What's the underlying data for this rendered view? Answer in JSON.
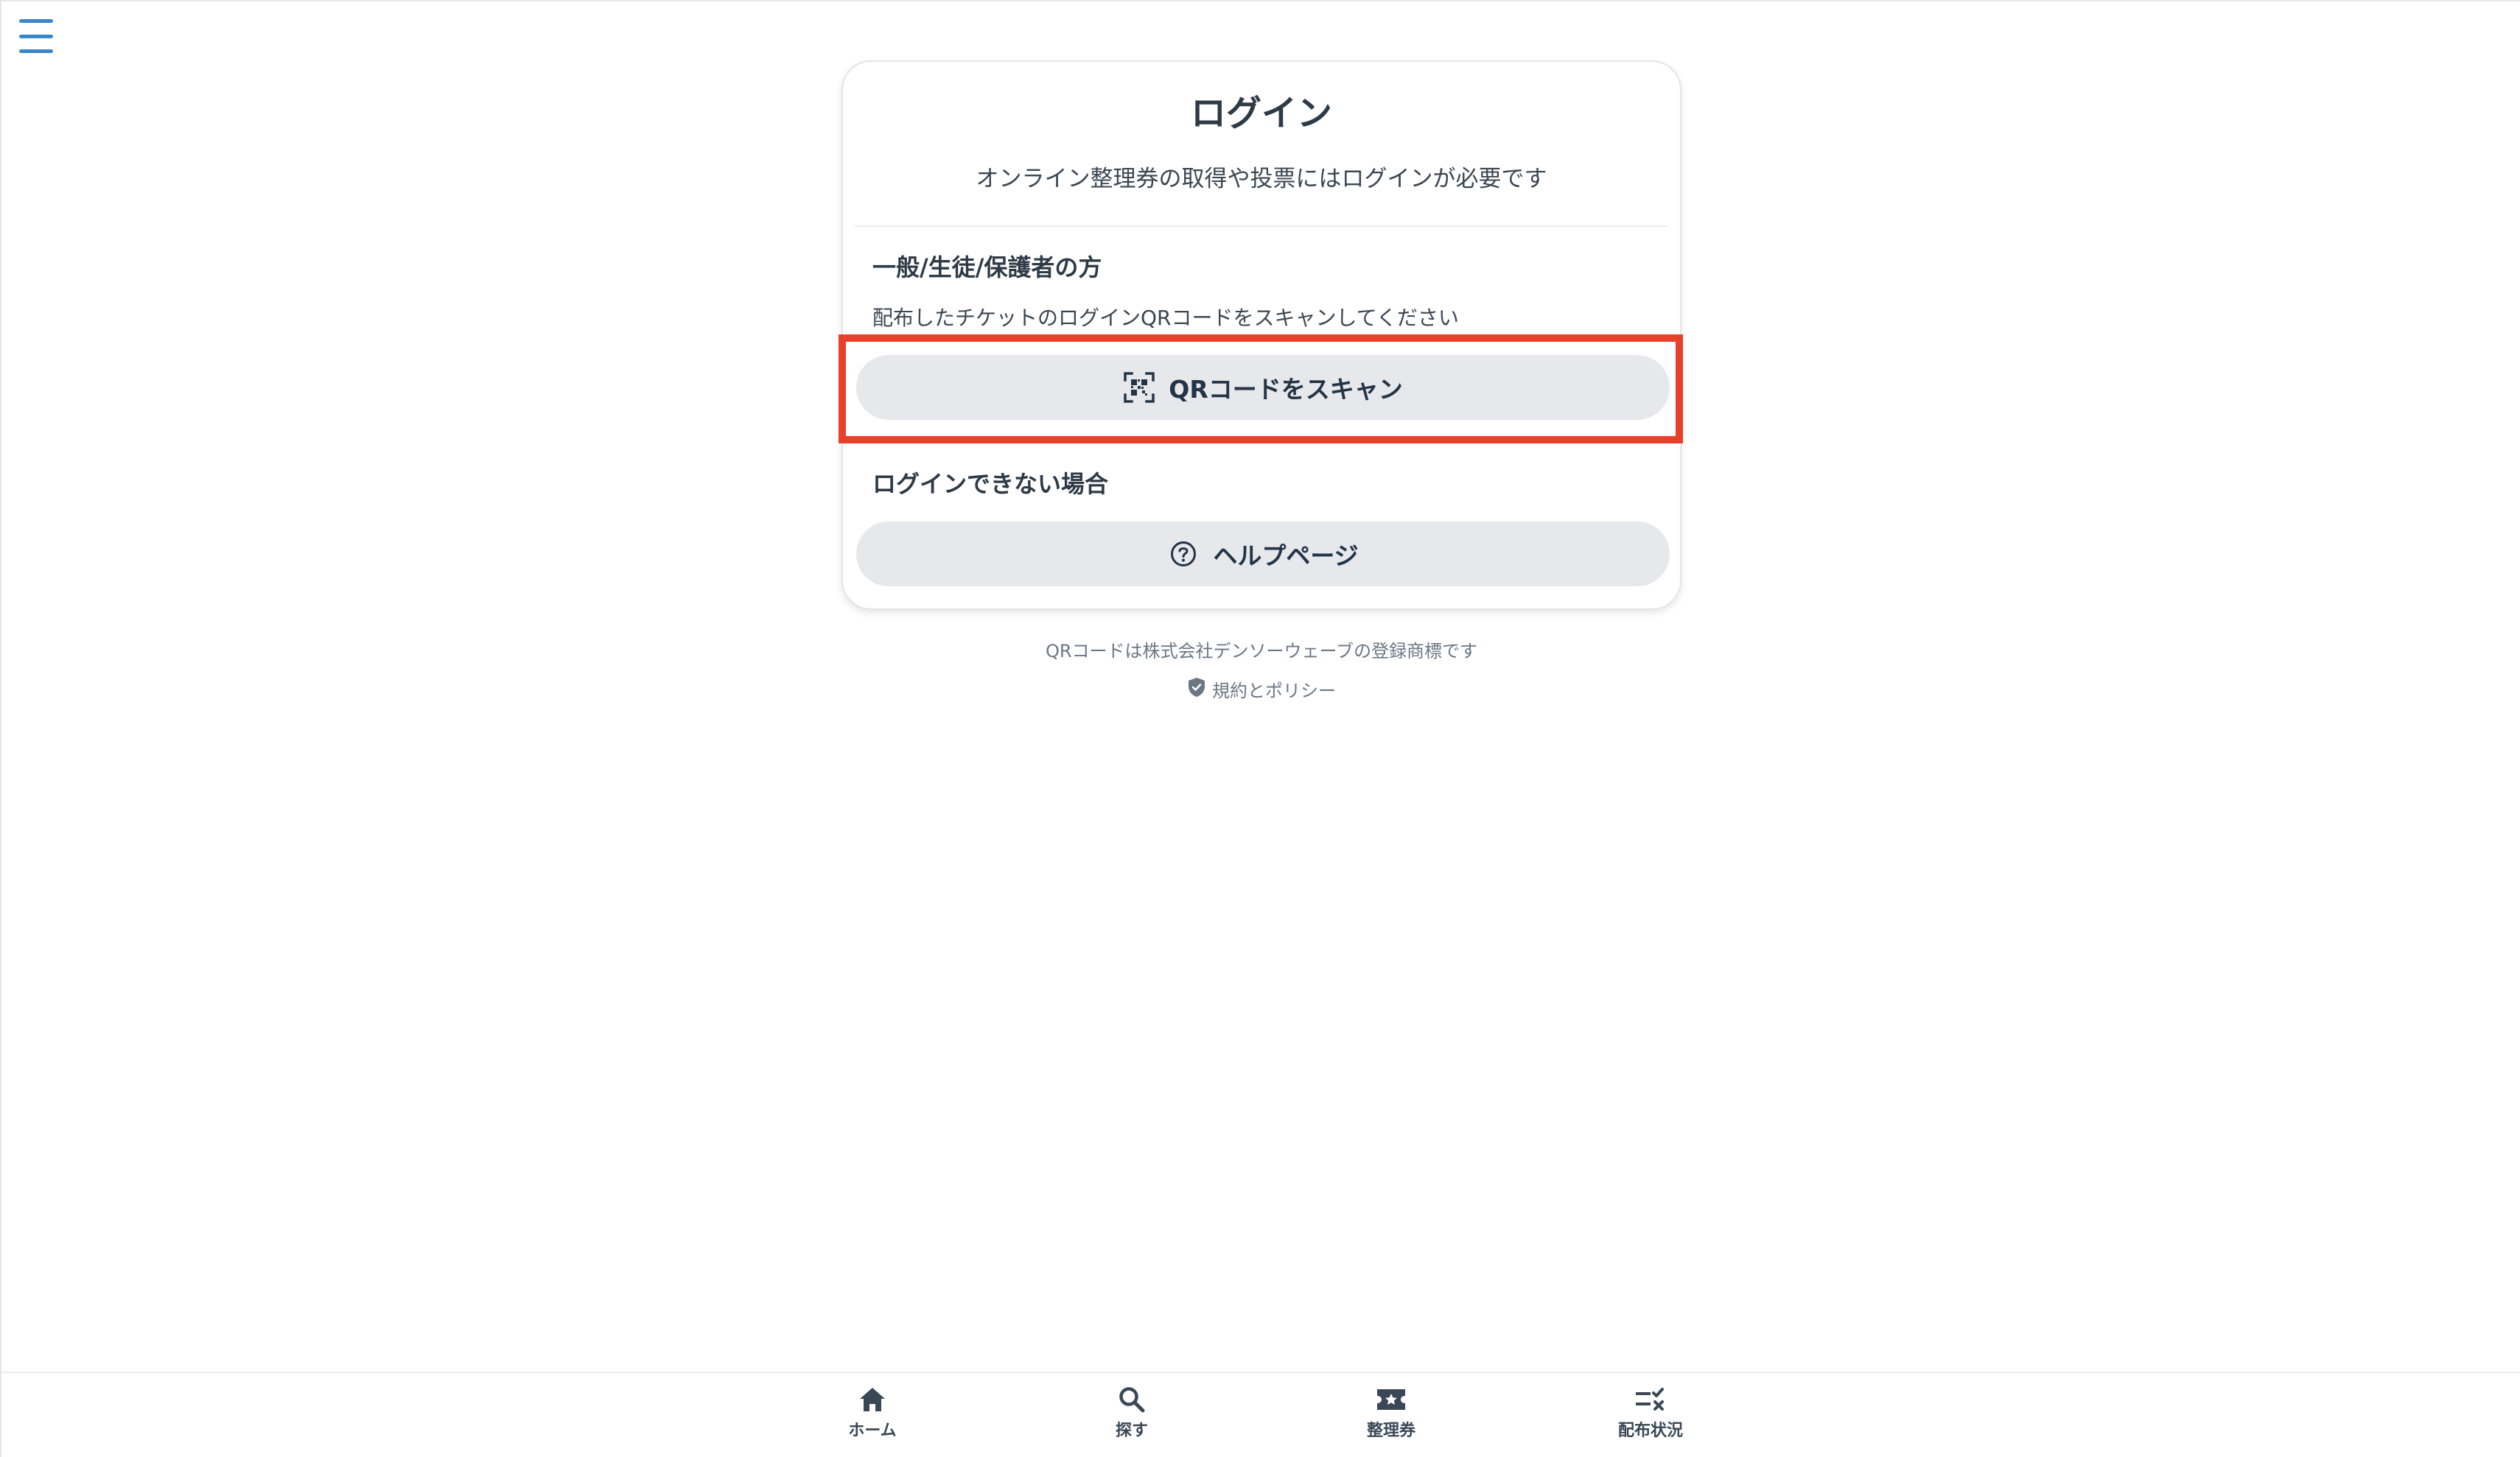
{
  "menu": {
    "icon": "hamburger-menu-icon",
    "color": "#3a86c8"
  },
  "card": {
    "title": "ログイン",
    "subtitle": "オンライン整理券の取得や投票にはログインが必要です",
    "general_section": {
      "heading": "一般/生徒/保護者の方",
      "description": "配布したチケットのログインQRコードをスキャンしてください",
      "scan_button": {
        "label": "QRコードをスキャン",
        "icon": "qr-code-scan-icon"
      }
    },
    "help_section": {
      "heading": "ログインできない場合",
      "help_button": {
        "label": "ヘルプページ",
        "icon": "help-circle-icon"
      }
    }
  },
  "footer": {
    "trademark": "QRコードは株式会社デンソーウェーブの登録商標です",
    "policy_link": {
      "label": "規約とポリシー",
      "icon": "shield-check-icon"
    }
  },
  "bottom_nav": {
    "items": [
      {
        "label": "ホーム",
        "icon": "home-icon"
      },
      {
        "label": "探す",
        "icon": "search-icon"
      },
      {
        "label": "整理券",
        "icon": "ticket-icon"
      },
      {
        "label": "配布状況",
        "icon": "checklist-icon"
      }
    ]
  },
  "colors": {
    "highlight": "#e8402a",
    "button_bg": "#e6e8eb",
    "text_dark": "#2e3a46",
    "text_muted": "#6b7784"
  }
}
